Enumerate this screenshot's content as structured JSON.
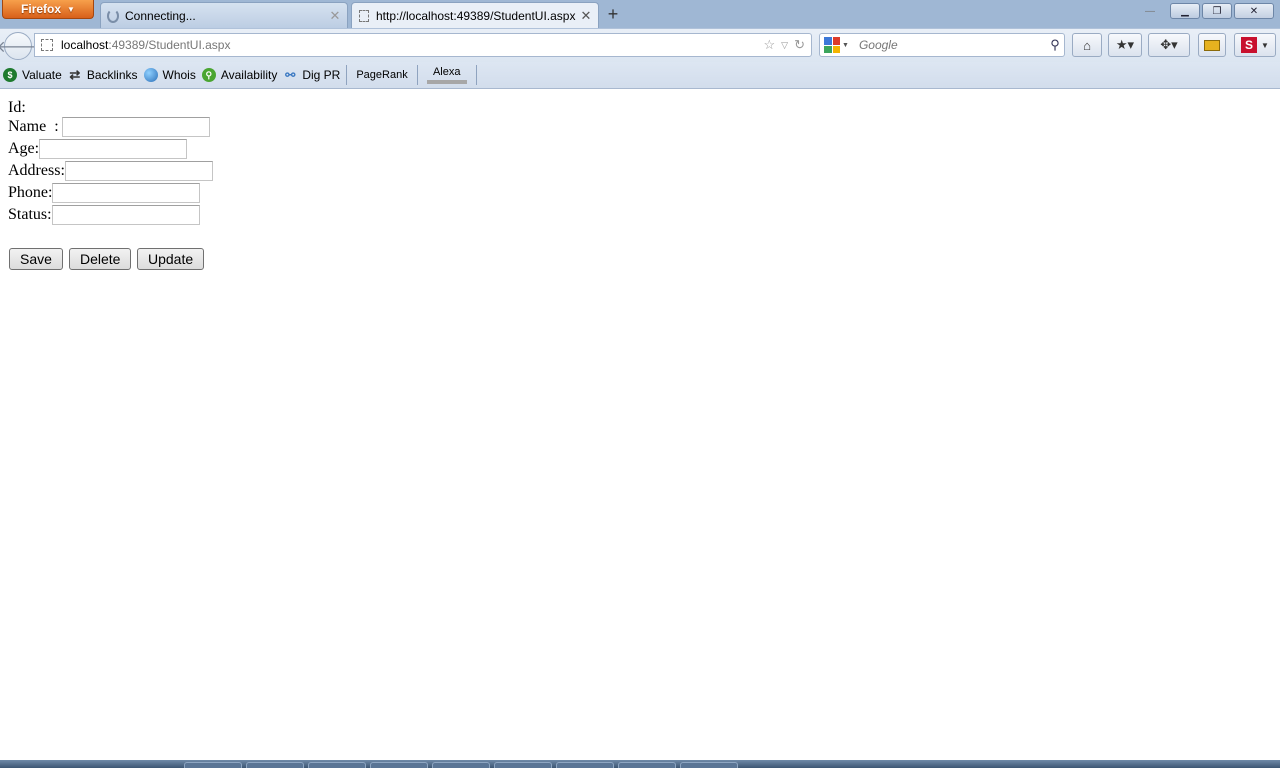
{
  "browser": {
    "menu_button": "Firefox",
    "tabs": [
      {
        "title": "Connecting...",
        "state": "loading"
      },
      {
        "title": "http://localhost:49389/StudentUI.aspx",
        "state": "active"
      }
    ],
    "new_tab_label": "+",
    "url": {
      "host": "localhost",
      "path": ":49389/StudentUI.aspx"
    },
    "search_placeholder": "Google",
    "bookmarks": [
      {
        "label": "Valuate",
        "icon": "dollar-icon",
        "color": "#1e7a2e"
      },
      {
        "label": "Backlinks",
        "icon": "arrows-icon",
        "color": "#333333"
      },
      {
        "label": "Whois",
        "icon": "globe-icon",
        "color": "#2b6fb8"
      },
      {
        "label": "Availability",
        "icon": "magnifier-icon",
        "color": "#4aa531"
      },
      {
        "label": "Dig PR",
        "icon": "network-icon",
        "color": "#3a78c2"
      }
    ],
    "toolbar_buttons": [
      "PageRank",
      "Alexa"
    ]
  },
  "form": {
    "fields": [
      {
        "label": "Id:",
        "value": ""
      },
      {
        "label": "Name  :",
        "value": ""
      },
      {
        "label": "Age:",
        "value": ""
      },
      {
        "label": "Address:",
        "value": ""
      },
      {
        "label": "Phone:",
        "value": ""
      },
      {
        "label": "Status:",
        "value": ""
      }
    ],
    "buttons": {
      "save": "Save",
      "delete": "Delete",
      "update": "Update"
    }
  }
}
